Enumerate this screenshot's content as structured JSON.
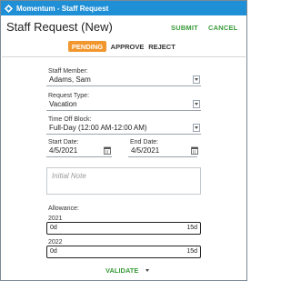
{
  "window": {
    "title": "Momentum - Staff Request",
    "icon": "app-logo-icon"
  },
  "header": {
    "title": "Staff Request (New)",
    "submit_label": "SUBMIT",
    "cancel_label": "CANCEL"
  },
  "status_tabs": [
    {
      "label": "PENDING",
      "active": true
    },
    {
      "label": "APPROVE",
      "active": false
    },
    {
      "label": "REJECT",
      "active": false
    }
  ],
  "form": {
    "staff_member": {
      "label": "Staff Member:",
      "value": "Adams, Sam"
    },
    "request_type": {
      "label": "Request Type:",
      "value": "Vacation"
    },
    "time_off_block": {
      "label": "Time Off Block:",
      "value": "Full-Day (12:00 AM-12:00 AM)"
    },
    "start_date": {
      "label": "Start Date:",
      "value": "4/5/2021"
    },
    "end_date": {
      "label": "End Date:",
      "value": "4/5/2021"
    },
    "note": {
      "placeholder": "Initial Note"
    }
  },
  "allowance": {
    "label": "Allowance:",
    "years": [
      {
        "year": "2021",
        "used": "0d",
        "total": "15d"
      },
      {
        "year": "2022",
        "used": "0d",
        "total": "15d"
      }
    ]
  },
  "footer": {
    "validate_label": "VALIDATE"
  },
  "colors": {
    "titlebar": "#1f8fd6",
    "accent_green": "#3a9a3a",
    "active_tab": "#f2962e"
  }
}
